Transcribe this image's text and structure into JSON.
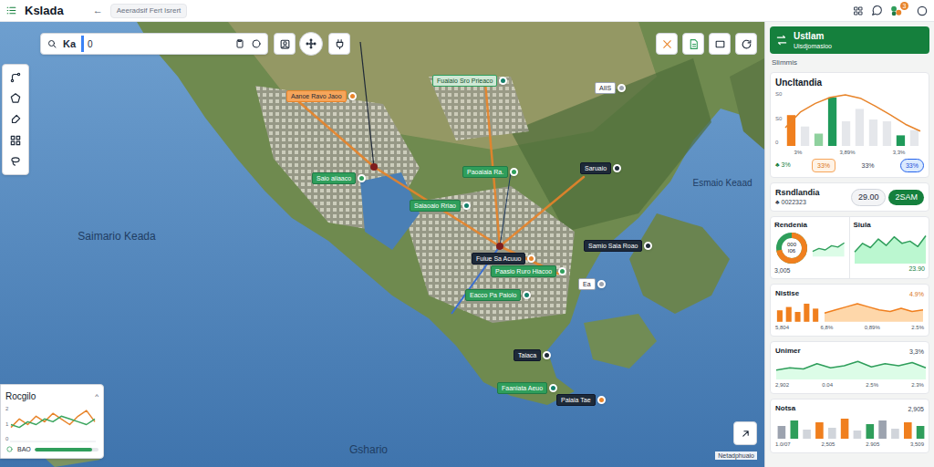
{
  "app": {
    "title": "Kslada",
    "back": "←",
    "tab": "Aeeradsif Fert Isrert",
    "notifications": "3"
  },
  "map": {
    "search": {
      "text": "Ka",
      "field": "0"
    },
    "regions": [
      "Saimario Keada",
      "Esmaio Keaad",
      "Gshario"
    ],
    "pins": [
      {
        "label": "Aanoe Ravo Jaoo",
        "kind": "orange",
        "color": "#e8842a"
      },
      {
        "label": "Fuaiaio Sro Prieaco",
        "kind": "mint",
        "color": "#14806a"
      },
      {
        "label": "Saio aiiaaco",
        "kind": "green",
        "color": "#2f9e5b"
      },
      {
        "label": "Paoaiaia Ra.",
        "kind": "green",
        "color": "#2f9e5b"
      },
      {
        "label": "Saruaio",
        "kind": "dark",
        "color": "#1e2a38"
      },
      {
        "label": "Saiaoaio Rriao",
        "kind": "green",
        "color": "#14806a"
      },
      {
        "label": "Samio Saia Roao",
        "kind": "dark",
        "color": "#1e2a38"
      },
      {
        "label": "Fuiue Sa Acuuo",
        "kind": "dark",
        "color": "#e8842a"
      },
      {
        "label": "Paasio Ruro Hiacoo",
        "kind": "green",
        "color": "#2f9e5b"
      },
      {
        "label": "Eacco Pa Paiolo",
        "kind": "green",
        "color": "#14806a"
      },
      {
        "label": "Taiaca",
        "kind": "dark",
        "color": "#1e2a38"
      },
      {
        "label": "Faaniata Aeuo",
        "kind": "green",
        "color": "#14806a"
      },
      {
        "label": "Paiaia Tae",
        "kind": "dark",
        "color": "#e8842a"
      },
      {
        "label": "Ea",
        "kind": "light",
        "color": "#9ca3af"
      },
      {
        "label": "AIIS",
        "kind": "light",
        "color": "#9ca3af"
      }
    ],
    "attribution": "Netadphuaio"
  },
  "legend": {
    "title": "Rocgilo",
    "toggle": "^",
    "ticks": [
      "2",
      "1",
      "0"
    ],
    "series": [
      {
        "values": [
          5,
          8,
          6,
          9,
          7,
          10,
          8,
          6,
          9,
          11,
          7
        ],
        "color": "#e8842a"
      },
      {
        "values": [
          6,
          5,
          7,
          6,
          8,
          7,
          9,
          8,
          7,
          6,
          8
        ],
        "color": "#3aa55d"
      }
    ],
    "footer": {
      "label": "BAO",
      "level": 0.9
    }
  },
  "panel": {
    "header": {
      "title": "Ustlam",
      "subtitle": "Uisdjomasioo"
    },
    "section": "Slimmis",
    "overview": {
      "title": "Uncltandia",
      "ticks": [
        "S0",
        "S0",
        "0"
      ],
      "bars": [
        {
          "value": 35,
          "color": "#f07f1e"
        },
        {
          "value": 22,
          "color": "#e5e7eb"
        },
        {
          "value": 14,
          "color": "#8fd19e"
        },
        {
          "value": 55,
          "color": "#1f9a5a"
        },
        {
          "value": 28,
          "color": "#e5e7eb"
        },
        {
          "value": 42,
          "color": "#e5e7eb"
        },
        {
          "value": 30,
          "color": "#e5e7eb"
        },
        {
          "value": 28,
          "color": "#e5e7eb"
        },
        {
          "value": 12,
          "color": "#1f9a5a"
        },
        {
          "value": 18,
          "color": "#e5e7eb"
        }
      ],
      "line": [
        20,
        38,
        48,
        55,
        58,
        54,
        45,
        35,
        24,
        16
      ],
      "labels": [
        "3%",
        "3,89%",
        "3,3%"
      ],
      "change": "♣ 3%",
      "chips": [
        {
          "label": "33%",
          "kind": "accent"
        },
        {
          "label": "33%",
          "kind": "plain"
        },
        {
          "label": "33%",
          "kind": "button"
        }
      ]
    },
    "summary": {
      "title": "Rsndlandia",
      "value": "♣ 0022323",
      "buttons": [
        {
          "label": "29.00",
          "selected": false
        },
        {
          "label": "2SAM",
          "selected": true
        }
      ]
    },
    "rendenia": {
      "title": "Rendenia",
      "donut": {
        "level": 0.72,
        "top": "000",
        "bottom": "I06"
      },
      "value": "3,005",
      "spark": [
        3,
        5,
        4,
        7,
        6,
        9
      ]
    },
    "siula": {
      "title": "Siula",
      "area": [
        10,
        18,
        14,
        22,
        16,
        24,
        18,
        20,
        15,
        25
      ],
      "value": "23.90"
    },
    "nistise": {
      "title": "Nistise",
      "corner": "4.9%",
      "bars": [
        14,
        18,
        12,
        22,
        16
      ],
      "area": [
        10,
        14,
        18,
        22,
        18,
        14,
        12,
        16,
        12,
        14
      ],
      "labels": [
        "5,804",
        "6,8%",
        "0,89%",
        "2.5%"
      ]
    },
    "unimer": {
      "title": "Unimer",
      "corner": "3,3%",
      "line": [
        8,
        10,
        9,
        14,
        10,
        12,
        16,
        11,
        14,
        12,
        15,
        10
      ],
      "labels": [
        "2,902",
        "0.04",
        "2.5%",
        "2.3%"
      ]
    },
    "notsa": {
      "title": "Notsa",
      "corner": "2,905",
      "bars": [
        {
          "value": 14,
          "color": "#9ca3af"
        },
        {
          "value": 20,
          "color": "#2f9e5b"
        },
        {
          "value": 10,
          "color": "#d1d5db"
        },
        {
          "value": 18,
          "color": "#f07f1e"
        },
        {
          "value": 12,
          "color": "#d1d5db"
        },
        {
          "value": 22,
          "color": "#f07f1e"
        },
        {
          "value": 9,
          "color": "#d1d5db"
        },
        {
          "value": 16,
          "color": "#2f9e5b"
        },
        {
          "value": 20,
          "color": "#9ca3af"
        },
        {
          "value": 11,
          "color": "#d1d5db"
        },
        {
          "value": 18,
          "color": "#f07f1e"
        },
        {
          "value": 14,
          "color": "#2f9e5b"
        }
      ],
      "labels": [
        "1.0/07",
        "2,505",
        "2.905",
        "3,509"
      ]
    }
  }
}
